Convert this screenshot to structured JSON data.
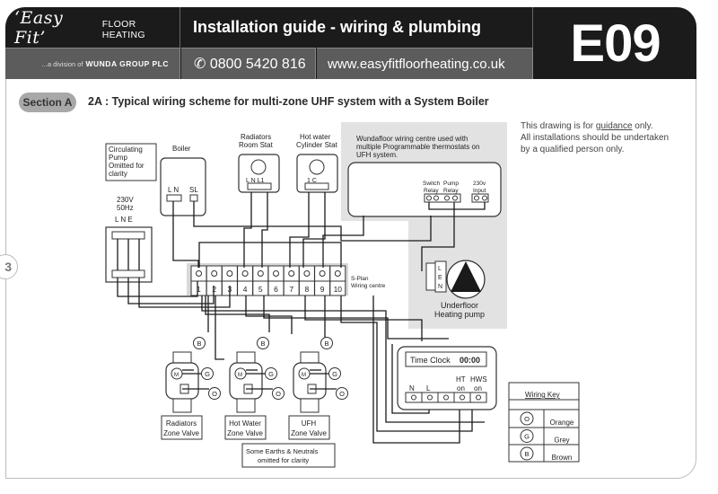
{
  "header": {
    "brand_script": "‘Easy Fit’",
    "brand_sub": "FLOOR HEATING",
    "division_prefix": "...a division of",
    "division_company": "WUNDA GROUP PLC",
    "title": "Installation guide - wiring & plumbing",
    "phone_icon": "phone-icon",
    "phone": "✆ 0800 5420 816",
    "website": "www.easyfitfloorheating.co.uk",
    "code": "E09"
  },
  "page_tab_number": "3",
  "section": {
    "pill": "Section A",
    "title": "2A : Typical wiring scheme for multi-zone UHF system with a System Boiler"
  },
  "disclaimer": {
    "line1_pre": "This drawing is for ",
    "line1_underlined": "guidance",
    "line1_post": " only.",
    "line2": "All installations should be undertaken",
    "line3": "by a qualified person only."
  },
  "diagram": {
    "circulating_note": [
      "Circulating",
      "Pump",
      "Omitted for",
      "clarity"
    ],
    "boiler": {
      "title": "Boiler",
      "terminals_left": "L N",
      "terminal_right": "SL"
    },
    "supply": {
      "voltage": "230V",
      "freq": "50Hz",
      "terminals": "L  N  E"
    },
    "room_stat": {
      "title_1": "Radiators",
      "title_2": "Room Stat",
      "terminals": "L N L1"
    },
    "cylinder_stat": {
      "title_1": "Hot  water",
      "title_2": "Cylinder Stat",
      "terminals": "1      C"
    },
    "wiring_centre_note": [
      "Wundafloor wiring centre used with",
      "multiple Programmable thermostats on",
      "UFH system."
    ],
    "relays": {
      "switch_1": "Switch",
      "switch_2": "Relay",
      "pump_1": "Pump",
      "pump_2": "Relay",
      "input_1": "230v",
      "input_2": "Input"
    },
    "splan": {
      "label_1": "S-Plan",
      "label_2": "Wiring centre",
      "terminals": [
        "1",
        "2",
        "3",
        "4",
        "5",
        "6",
        "7",
        "8",
        "9",
        "10"
      ]
    },
    "pump": {
      "terminals": [
        "L",
        "E",
        "N"
      ],
      "title_1": "Underfloor",
      "title_2": "Heating pump"
    },
    "valves": [
      {
        "title_1": "Radiators",
        "title_2": "Zone Valve"
      },
      {
        "title_1": "Hot Water",
        "title_2": "Zone Valve"
      },
      {
        "title_1": "UFH",
        "title_2": "Zone Valve"
      }
    ],
    "motor_label": "M",
    "wire_markers": {
      "brown": "B",
      "grey": "G",
      "orange": "O"
    },
    "earths_note": [
      "Some  Earths  &  Neutrals",
      "omitted for clarity"
    ],
    "time_clock": {
      "title": "Time Clock",
      "time": "00:00",
      "n": "N",
      "l": "L",
      "ht_1": "HT",
      "ht_2": "on",
      "hws_1": "HWS",
      "hws_2": "on"
    },
    "wiring_key": {
      "title": "Wiring Key",
      "rows": [
        {
          "symbol": "O",
          "color": "Orange"
        },
        {
          "symbol": "G",
          "color": "Grey"
        },
        {
          "symbol": "B",
          "color": "Brown"
        }
      ]
    }
  }
}
